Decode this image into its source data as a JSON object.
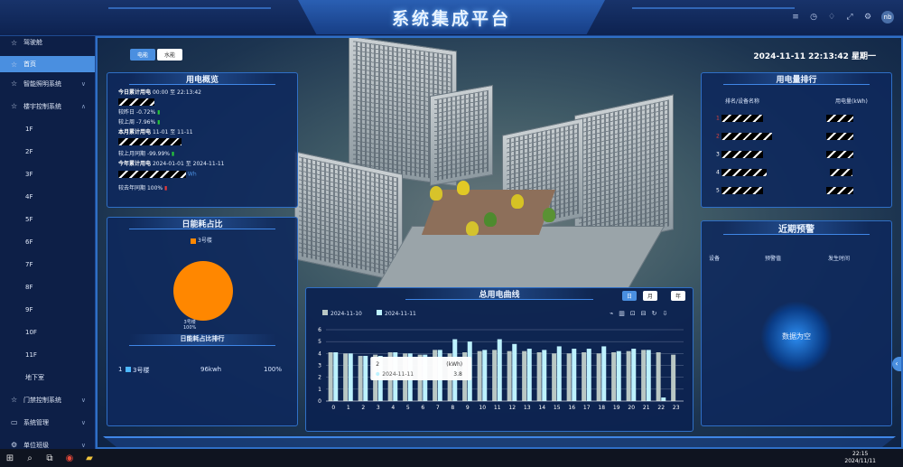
{
  "header": {
    "title": "系统集成平台",
    "avatar_text": "nb"
  },
  "sidebar": {
    "items": [
      {
        "label": "驾驶舱",
        "icon": "star-icon",
        "active": false
      },
      {
        "label": "首页",
        "icon": "star-icon",
        "active": true
      },
      {
        "label": "智能照明系统",
        "icon": "star-icon",
        "chev": "∨"
      },
      {
        "label": "楼宇控制系统",
        "icon": "star-icon",
        "chev": "∧"
      }
    ],
    "floors": [
      "1F",
      "2F",
      "3F",
      "4F",
      "5F",
      "6F",
      "7F",
      "8F",
      "9F",
      "10F",
      "11F",
      "地下室"
    ],
    "bottom_items": [
      {
        "label": "门禁控制系统",
        "chev": "∨"
      },
      {
        "label": "系统管理",
        "chev": "∨"
      },
      {
        "label": "单位班级",
        "chev": "∨"
      }
    ]
  },
  "main": {
    "tabs": [
      {
        "label": "电能"
      },
      {
        "label": "水能"
      }
    ],
    "datetime": "2024-11-11 22:13:42 星期一"
  },
  "overview": {
    "title": "用电概览",
    "today_label": "今日累计用电",
    "today_range": "00:00 至 22:13:42",
    "yday_label": "较昨日",
    "yday_value": "-0.72%",
    "week_label": "较上周",
    "week_value": "-7.96%",
    "month_label": "本月累计用电",
    "month_range": "11-01 至 11-11",
    "lastmonth_label": "较上月同期",
    "lastmonth_value": "-99.99%",
    "year_label": "今年累计用电",
    "year_range": "2024-01-01 至 2024-11-11",
    "year_unit": "Wh",
    "lastyear_label": "较去年同期",
    "lastyear_value": "100%"
  },
  "ranking": {
    "title": "用电量排行",
    "col_name": "排名/设备名称",
    "col_value": "用电量(kWh)",
    "ranks": [
      "1",
      "2",
      "3",
      "4",
      "5"
    ]
  },
  "pie": {
    "title": "日能耗占比",
    "legend": "3号楼",
    "slice_label": "3号楼",
    "slice_percent": "100%",
    "rank_title": "日能耗占比排行",
    "row": {
      "index": "1",
      "name": "3号楼",
      "value": "96kwh",
      "percent": "100%"
    },
    "color": "#ff8700"
  },
  "alerts": {
    "title": "近期预警",
    "col_device": "设备",
    "col_value": "预警值",
    "col_time": "发生时间",
    "empty_text": "数据为空"
  },
  "chart": {
    "controls": [
      {
        "label": "日"
      },
      {
        "label": "月"
      },
      {
        "label": "年"
      }
    ]
  },
  "chart_data": {
    "type": "bar",
    "title": "总用电曲线",
    "categories": [
      "0",
      "1",
      "2",
      "3",
      "4",
      "5",
      "6",
      "7",
      "8",
      "9",
      "10",
      "11",
      "12",
      "13",
      "14",
      "15",
      "16",
      "17",
      "18",
      "19",
      "20",
      "21",
      "22",
      "23"
    ],
    "series": [
      {
        "name": "2024-11-10",
        "color": "#b9c7c4",
        "values": [
          4.1,
          4.0,
          3.8,
          3.9,
          4.1,
          4.0,
          3.9,
          4.3,
          4.0,
          4.1,
          4.2,
          4.3,
          4.2,
          4.2,
          4.1,
          4.0,
          4.0,
          4.1,
          4.0,
          4.1,
          4.2,
          4.3,
          4.1,
          3.9
        ]
      },
      {
        "name": "2024-11-11",
        "color": "#bdf2ff",
        "values": [
          4.1,
          4.0,
          3.8,
          3.8,
          4.1,
          4.0,
          3.9,
          4.3,
          5.2,
          5.0,
          4.3,
          5.2,
          4.8,
          4.4,
          4.3,
          4.6,
          4.4,
          4.4,
          4.6,
          4.2,
          4.4,
          4.3,
          0.3,
          null
        ]
      }
    ],
    "ylim": [
      0,
      6
    ],
    "yticks": [
      "0",
      "1",
      "2",
      "3",
      "4",
      "5",
      "6"
    ],
    "tooltip": {
      "category": "2",
      "unit": "(kWh)",
      "series": "2024-11-11",
      "value": "3.8"
    }
  },
  "taskbar": {
    "time": "22:15",
    "date": "2024/11/11"
  }
}
